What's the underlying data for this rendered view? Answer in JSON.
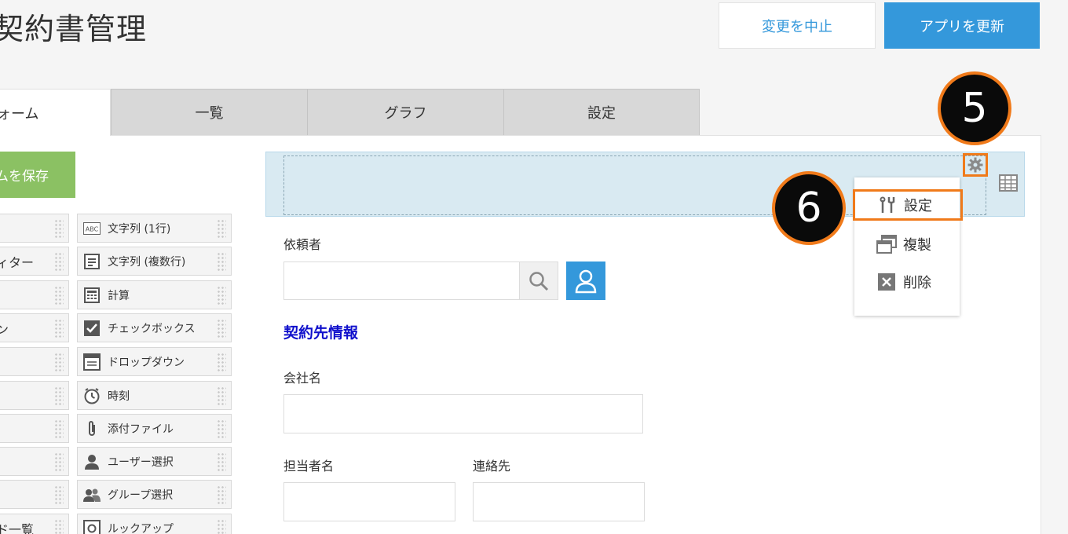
{
  "header": {
    "app_title": "契約書管理",
    "cancel_label": "変更を中止",
    "update_label": "アプリを更新"
  },
  "tabs": [
    "ォーム",
    "一覧",
    "グラフ",
    "設定"
  ],
  "sidebar": {
    "save_label": "ムを保存",
    "left_items": [
      "",
      "ィター",
      "",
      "ン",
      "",
      "",
      "",
      "",
      "",
      "ド一覧"
    ],
    "right_items": [
      {
        "label": "文字列 (1行)",
        "icon": "text-line-icon"
      },
      {
        "label": "文字列 (複数行)",
        "icon": "text-multiline-icon"
      },
      {
        "label": "計算",
        "icon": "calculator-icon"
      },
      {
        "label": "チェックボックス",
        "icon": "checkbox-icon"
      },
      {
        "label": "ドロップダウン",
        "icon": "dropdown-icon"
      },
      {
        "label": "時刻",
        "icon": "clock-icon"
      },
      {
        "label": "添付ファイル",
        "icon": "paperclip-icon"
      },
      {
        "label": "ユーザー選択",
        "icon": "user-icon"
      },
      {
        "label": "グループ選択",
        "icon": "group-icon"
      },
      {
        "label": "ルックアップ",
        "icon": "lookup-icon"
      }
    ]
  },
  "menu": {
    "settings_label": "設定",
    "duplicate_label": "複製",
    "delete_label": "削除"
  },
  "callouts": {
    "five": "5",
    "six": "6"
  },
  "form": {
    "requester_label": "依頼者",
    "section_title": "契約先情報",
    "company_label": "会社名",
    "contact_person_label": "担当者名",
    "contact_label": "連絡先"
  },
  "colors": {
    "accent": "#3498db",
    "callout_border": "#f07a1a",
    "save_green": "#8bc163",
    "section_title": "#1010cc"
  }
}
